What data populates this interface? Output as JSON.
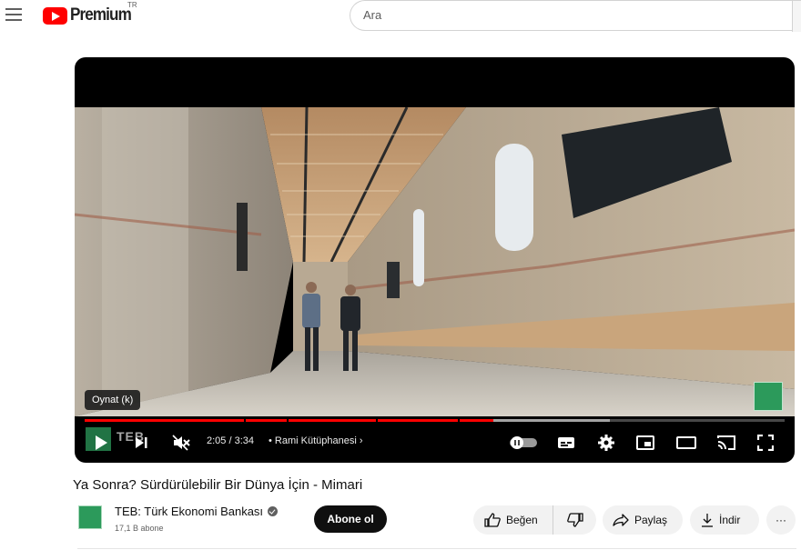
{
  "header": {
    "logo_text": "Premium",
    "logo_superscript": "TR",
    "search_placeholder": "Ara"
  },
  "player": {
    "tooltip": "Oynat (k)",
    "current_time": "2:05",
    "duration": "3:34",
    "time_display": "2:05 / 3:34",
    "chapter": "• Rami Kütüphanesi",
    "overlay_brand": "TEB",
    "progress_played_fraction": 0.584,
    "progress_loaded_fraction": 0.75
  },
  "video": {
    "title": "Ya Sonra? Sürdürülebilir Bir Dünya İçin - Mimari"
  },
  "channel": {
    "name": "TEB: Türk Ekonomi Bankası",
    "subscribers": "17,1 B abone",
    "subscribe_label": "Abone ol"
  },
  "actions": {
    "like_label": "Beğen",
    "share_label": "Paylaş",
    "download_label": "İndir",
    "more_label": "···"
  },
  "colors": {
    "brand_red": "#ff0000",
    "teb_green": "#2c9a5b"
  }
}
